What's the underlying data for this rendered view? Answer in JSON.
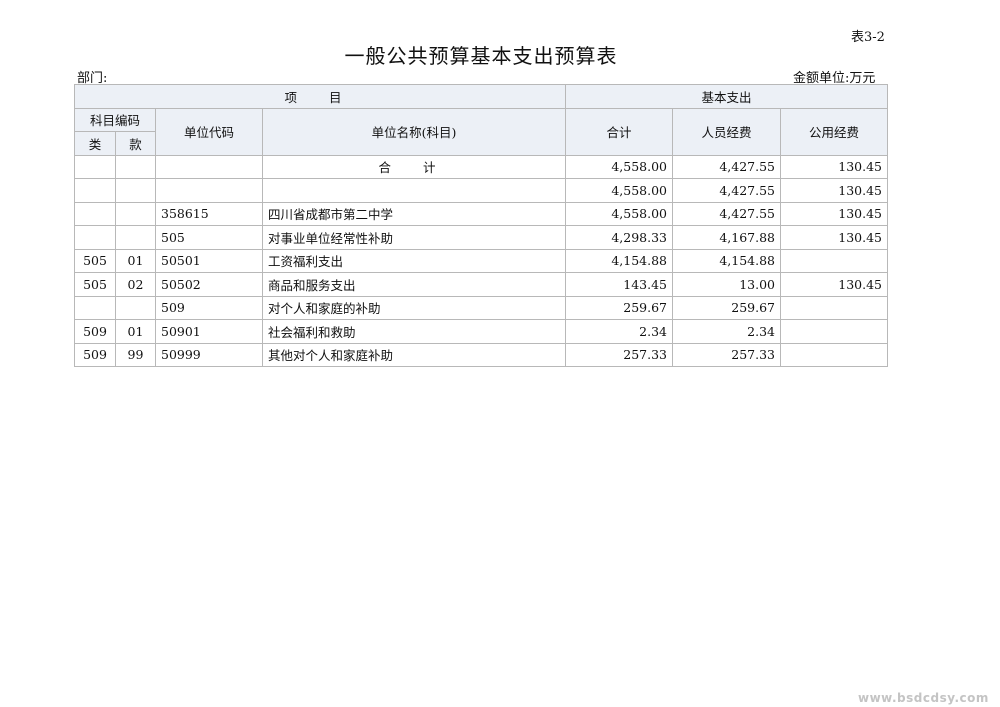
{
  "header": {
    "table_id": "表3-2",
    "title": "一般公共预算基本支出预算表",
    "dept_label": "部门:",
    "unit_label": "金额单位:万元"
  },
  "columns": {
    "project": "项 目",
    "basic_expenditure": "基本支出",
    "subject_code": "科目编码",
    "class": "类",
    "item": "款",
    "unit_code": "单位代码",
    "unit_name": "单位名称(科目)",
    "total": "合计",
    "personnel": "人员经费",
    "public": "公用经费"
  },
  "rows": [
    {
      "cls": "",
      "kuan": "",
      "code": "",
      "name": "合 计",
      "total": "4,558.00",
      "personnel": "4,427.55",
      "public": "130.45"
    },
    {
      "cls": "",
      "kuan": "",
      "code": "",
      "name": "",
      "total": "4,558.00",
      "personnel": "4,427.55",
      "public": "130.45"
    },
    {
      "cls": "",
      "kuan": "",
      "code": "358615",
      "name": "四川省成都市第二中学",
      "total": "4,558.00",
      "personnel": "4,427.55",
      "public": "130.45"
    },
    {
      "cls": "",
      "kuan": "",
      "code": "505",
      "name": "对事业单位经常性补助",
      "total": "4,298.33",
      "personnel": "4,167.88",
      "public": "130.45"
    },
    {
      "cls": "505",
      "kuan": "01",
      "code": "50501",
      "name": "工资福利支出",
      "total": "4,154.88",
      "personnel": "4,154.88",
      "public": ""
    },
    {
      "cls": "505",
      "kuan": "02",
      "code": "50502",
      "name": "商品和服务支出",
      "total": "143.45",
      "personnel": "13.00",
      "public": "130.45"
    },
    {
      "cls": "",
      "kuan": "",
      "code": "509",
      "name": "对个人和家庭的补助",
      "total": "259.67",
      "personnel": "259.67",
      "public": ""
    },
    {
      "cls": "509",
      "kuan": "01",
      "code": "50901",
      "name": "社会福利和救助",
      "total": "2.34",
      "personnel": "2.34",
      "public": ""
    },
    {
      "cls": "509",
      "kuan": "99",
      "code": "50999",
      "name": "其他对个人和家庭补助",
      "total": "257.33",
      "personnel": "257.33",
      "public": ""
    }
  ],
  "watermark": "www.bsdcdsy.com"
}
